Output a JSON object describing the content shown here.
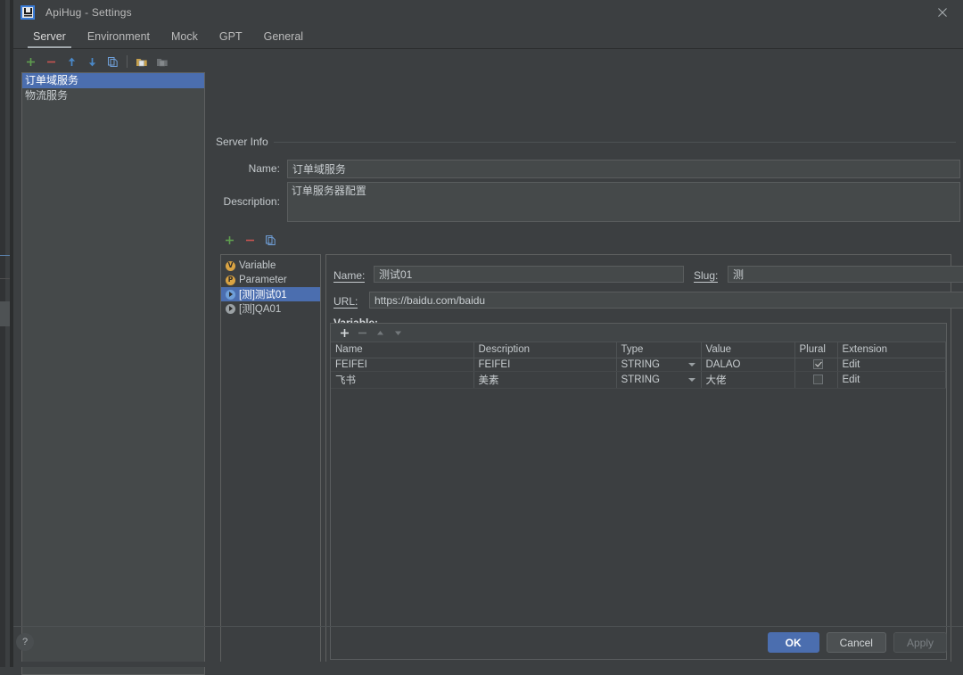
{
  "window": {
    "title": "ApiHug - Settings",
    "app_icon": "apihug-logo-icon",
    "close_icon": "close-icon"
  },
  "tabs": [
    {
      "label": "Server",
      "active": true
    },
    {
      "label": "Environment",
      "active": false
    },
    {
      "label": "Mock",
      "active": false
    },
    {
      "label": "GPT",
      "active": false
    },
    {
      "label": "General",
      "active": false
    }
  ],
  "server_toolbar": [
    {
      "name": "add-server-button",
      "icon": "plus-icon",
      "color": "#5f9e4f"
    },
    {
      "name": "remove-server-button",
      "icon": "minus-icon",
      "color": "#c75450"
    },
    {
      "name": "move-up-button",
      "icon": "arrow-up-icon",
      "color": "#4a88c7"
    },
    {
      "name": "move-down-button",
      "icon": "arrow-down-icon",
      "color": "#4a88c7"
    },
    {
      "name": "copy-server-button",
      "icon": "copy-icon",
      "color": "#6f9fd8"
    },
    {
      "name": "import-button",
      "icon": "folder-import-icon",
      "color": "#c7a04a"
    },
    {
      "name": "export-button",
      "icon": "folder-export-icon",
      "color": "#7a7f82"
    }
  ],
  "server_list": [
    {
      "label": "订单域服务",
      "selected": true
    },
    {
      "label": "物流服务",
      "selected": false
    }
  ],
  "server_info": {
    "group_title": "Server Info",
    "name_label": "Name:",
    "name_value": "订单域服务",
    "description_label": "Description:",
    "description_value": "订单服务器配置"
  },
  "variable_toolbar": [
    {
      "name": "add-item-button",
      "icon": "plus-icon",
      "color": "#5f9e4f"
    },
    {
      "name": "remove-item-button",
      "icon": "minus-icon",
      "color": "#c75450"
    },
    {
      "name": "copy-item-button",
      "icon": "copy-icon",
      "color": "#6f9fd8"
    }
  ],
  "tree": [
    {
      "label": "Variable",
      "icon": "variable-icon",
      "icon_letter": "V",
      "type": "v",
      "selected": false
    },
    {
      "label": "Parameter",
      "icon": "parameter-icon",
      "icon_letter": "P",
      "type": "p",
      "selected": false
    },
    {
      "label": "[测]测试01",
      "icon": "endpoint-icon",
      "icon_letter": "",
      "type": "play-blue",
      "selected": true
    },
    {
      "label": "[测]QA01",
      "icon": "endpoint-icon",
      "icon_letter": "",
      "type": "play",
      "selected": false
    }
  ],
  "detail": {
    "name_label": "Name:",
    "name_value": "测试01",
    "slug_label": "Slug:",
    "slug_value": "测",
    "url_label": "URL:",
    "url_value": "https://baidu.com/baidu",
    "variable_label": "Variable:"
  },
  "var_table_toolbar": [
    {
      "name": "add-variable-button",
      "icon": "plus-icon",
      "enabled": true
    },
    {
      "name": "remove-variable-button",
      "icon": "minus-icon",
      "enabled": false
    },
    {
      "name": "move-variable-up-button",
      "icon": "triangle-up-icon",
      "enabled": false
    },
    {
      "name": "move-variable-down-button",
      "icon": "triangle-down-icon",
      "enabled": false
    }
  ],
  "var_table": {
    "columns": [
      "Name",
      "Description",
      "Type",
      "Value",
      "Plural",
      "Extension"
    ],
    "rows": [
      {
        "name": "FEIFEI",
        "description": "FEIFEI",
        "type": "STRING",
        "value": "DALAO",
        "plural": true,
        "extension": "Edit"
      },
      {
        "name": "飞书",
        "description": "美素",
        "type": "STRING",
        "value": "大佬",
        "plural": false,
        "extension": "Edit"
      }
    ]
  },
  "footer": {
    "help_label": "?",
    "ok_label": "OK",
    "cancel_label": "Cancel",
    "apply_label": "Apply"
  },
  "colors": {
    "accent": "#4b6eaf",
    "window_bg": "#3c3f41",
    "field_bg": "#45494a",
    "text": "#c4c9cc"
  }
}
